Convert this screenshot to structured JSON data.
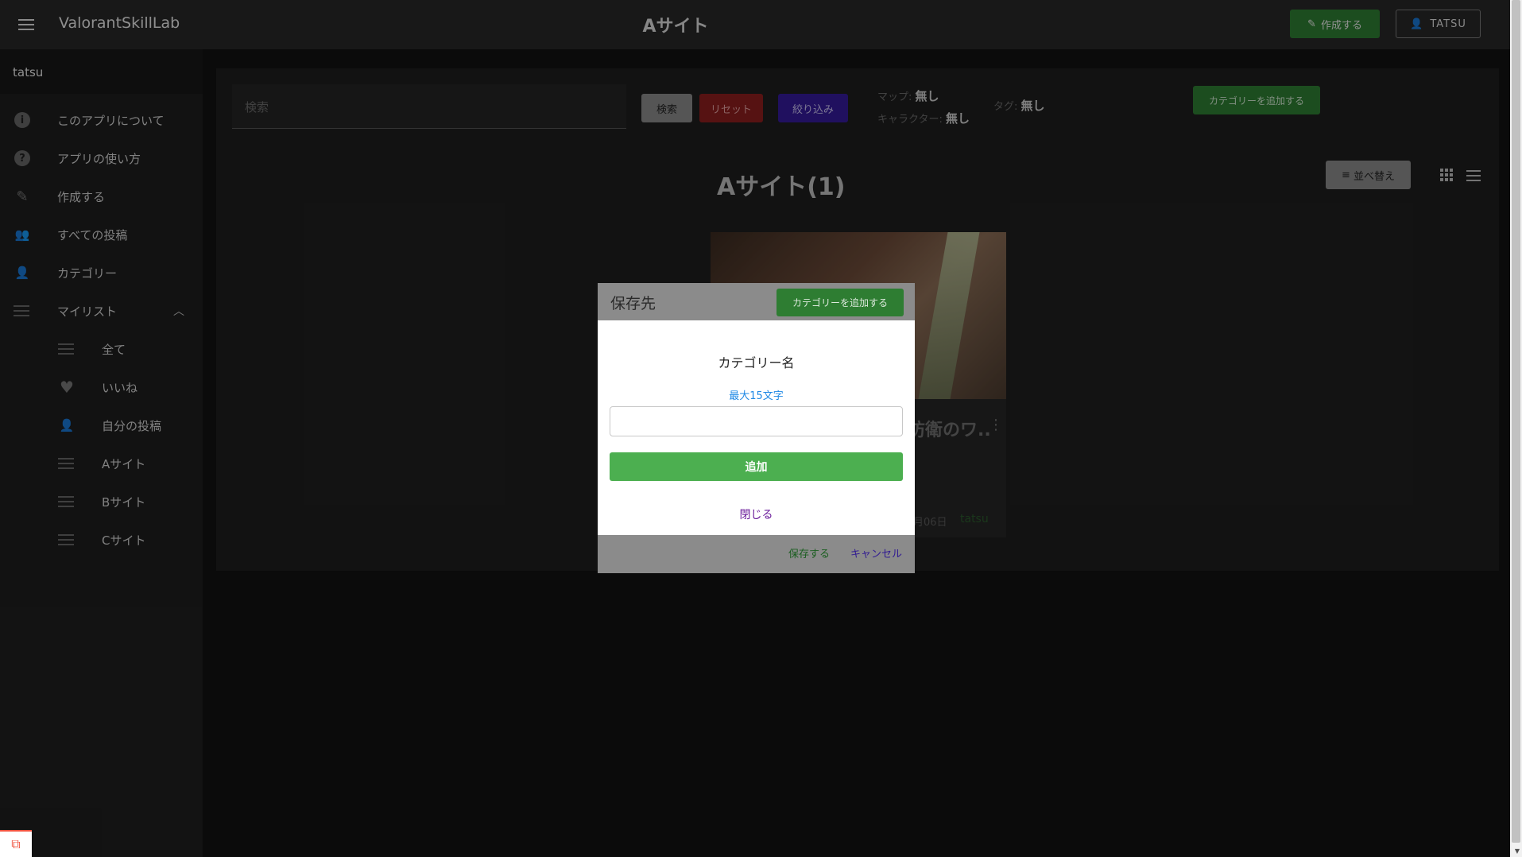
{
  "app_bar": {
    "app_title": "ValorantSkillLab",
    "page_title": "Aサイト",
    "create_label": "作成する",
    "user_label": "TATSU"
  },
  "sidebar": {
    "user_name": "tatsu",
    "items": [
      {
        "label": "このアプリについて",
        "icon": "info-icon"
      },
      {
        "label": "アプリの使い方",
        "icon": "help-icon"
      },
      {
        "label": "作成する",
        "icon": "pencil-icon"
      },
      {
        "label": "すべての投稿",
        "icon": "people-icon"
      },
      {
        "label": "カテゴリー",
        "icon": "person-icon"
      },
      {
        "label": "マイリスト",
        "icon": "list-icon"
      }
    ],
    "sub_items": [
      {
        "label": "全て",
        "icon": "view-list-icon"
      },
      {
        "label": "いいね",
        "icon": "heart-icon"
      },
      {
        "label": "自分の投稿",
        "icon": "person-icon"
      },
      {
        "label": "Aサイト",
        "icon": "list-icon"
      },
      {
        "label": "Bサイト",
        "icon": "list-icon"
      },
      {
        "label": "Cサイト",
        "icon": "list-icon"
      }
    ]
  },
  "toolbar": {
    "search_placeholder": "検索",
    "search_label": "検索",
    "reset_label": "リセット",
    "filter_label": "絞り込み",
    "map_label": "マップ:",
    "map_value": "無し",
    "character_label": "キャラクター:",
    "character_value": "無し",
    "tag_label": "タグ:",
    "tag_value": "無し",
    "add_category_label": "カテゴリーを追加する"
  },
  "list": {
    "title": "Aサイト(1)",
    "sort_label": "並べ替え"
  },
  "card": {
    "title": "防衛のワ..",
    "date": "月06日",
    "author": "tatsu"
  },
  "save_dialog": {
    "title": "保存先",
    "add_category_label": "カテゴリーを追加する",
    "save_label": "保存する",
    "cancel_label": "キャンセル"
  },
  "add_dialog": {
    "title": "カテゴリー名",
    "hint": "最大15文字",
    "input_value": "",
    "add_label": "追加",
    "close_label": "閉じる"
  },
  "colors": {
    "accent_green": "#2e7d32",
    "button_green": "#4caf50",
    "reset_red": "#8b1d1d",
    "filter_purple": "#341a9a",
    "hint_blue": "#1e88e5"
  }
}
